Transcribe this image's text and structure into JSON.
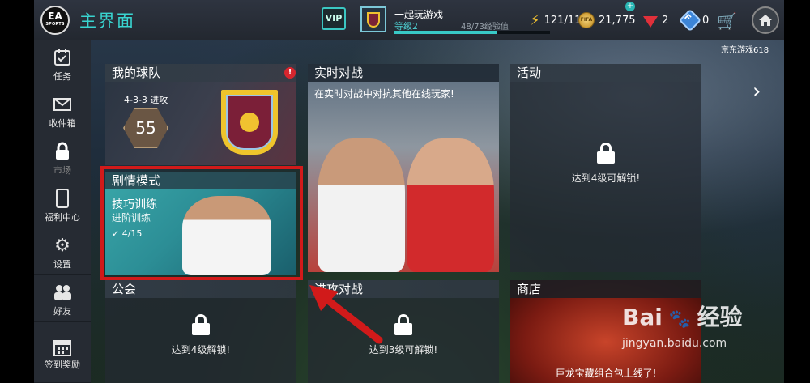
{
  "header": {
    "page_title": "主界面",
    "vip_label": "VIP",
    "profile_name": "一起玩游戏",
    "level_label": "等级2",
    "xp_text": "48/73经验值",
    "xp_progress": 0.66,
    "energy": "121/11",
    "coins": "21,775",
    "gems": "2",
    "fifa_points": "0",
    "ea_logo_text": "EA",
    "ea_logo_sub": "SPORTS"
  },
  "sidebar": {
    "items": [
      {
        "label": "任务",
        "icon": "task-icon"
      },
      {
        "label": "收件箱",
        "icon": "mail-icon"
      },
      {
        "label": "市场",
        "icon": "lock-icon"
      },
      {
        "label": "福利中心",
        "icon": "card-icon"
      },
      {
        "label": "设置",
        "icon": "gear-icon"
      },
      {
        "label": "好友",
        "icon": "friends-icon"
      },
      {
        "label": "签到奖励",
        "icon": "calendar-icon"
      }
    ]
  },
  "tiles": {
    "my_team": {
      "title": "我的球队",
      "formation": "4-3-3 进攻",
      "rating": "55",
      "badge": "!"
    },
    "story": {
      "title": "剧情模式",
      "subtitle": "技巧训练",
      "subtitle2": "进阶训练",
      "progress": "4/15"
    },
    "live": {
      "title": "实时对战",
      "description": "在实时对战中对抗其他在线玩家!"
    },
    "events": {
      "title": "活动",
      "lock_text": "达到4级可解锁!"
    },
    "league": {
      "title": "公会",
      "lock_text": "达到4级解锁!"
    },
    "attack": {
      "title": "进攻对战",
      "lock_text": "达到3级可解锁!"
    },
    "shop": {
      "title": "商店",
      "caption": "巨龙宝藏组合包上线了!"
    }
  },
  "ticker_text": "京东游戏618",
  "watermark": {
    "main": "Bai",
    "mid": "经验",
    "url": "jingyan.baidu.com"
  },
  "colors": {
    "accent": "#39d4d0",
    "highlight": "#d11a1a"
  }
}
